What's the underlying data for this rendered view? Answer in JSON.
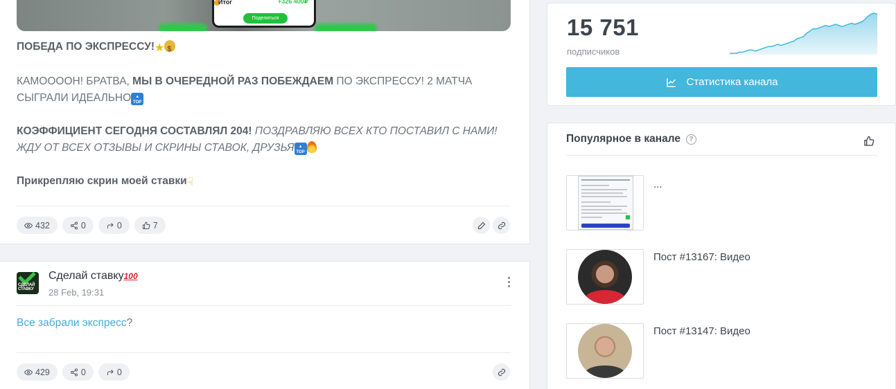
{
  "post1": {
    "image": {
      "itog_label": "Итог",
      "amount": "+326 400₽",
      "share_button": "Поделиться"
    },
    "title": "ПОБЕДА ПО ЭКСПРЕССУ!",
    "para1_a": "КАМООООН! БРАТВА, ",
    "para1_b": "МЫ В ОЧЕРЕДНОЙ РАЗ ПОБЕЖДАЕМ",
    "para1_c": " ПО ЭКСПРЕССУ! 2 МАТЧА СЫГРАЛИ ИДЕАЛЬНО",
    "para2_a": "КОЭФФИЦИЕНТ СЕГОДНЯ СОСТАВЛЯЛ 204!",
    "para2_b": " ПОЗДРАВЛЯЮ ВСЕХ КТО ПОСТАВИЛ С НАМИ! ЖДУ ОТ ВСЕХ ОТЗЫВЫ И СКРИНЫ СТАВОК, ДРУЗЬЯ",
    "para3": "Прикрепляю скрин моей ставки",
    "stats": {
      "views": "432",
      "shares": "0",
      "forwards": "0",
      "likes": "7"
    }
  },
  "post2": {
    "avatar_text": "СДЕЛАЙ СТАВКУ",
    "channel_name": "Сделай ставку",
    "channel_emoji": "100",
    "date": "28 Feb, 19:31",
    "link_text": "Все забрали экспресс",
    "text_suffix": "?",
    "stats": {
      "views": "429",
      "shares": "0",
      "forwards": "0"
    }
  },
  "channel_stats": {
    "subscribers": "15 751",
    "subscribers_label": "подписчиков",
    "stats_button": "Статистика канала",
    "accent_color": "#44b7dd"
  },
  "popular": {
    "title": "Популярное в канале",
    "help_icon": "?",
    "items": [
      {
        "label": "..."
      },
      {
        "label": "Пост #13167: Видео"
      },
      {
        "label": "Пост #13147: Видео"
      }
    ]
  },
  "chart_data": {
    "type": "area",
    "title": "",
    "series": [
      {
        "values": [
          2,
          2,
          2,
          3,
          3,
          4,
          5,
          5,
          4,
          5,
          6,
          7,
          8,
          8,
          9,
          10,
          9,
          10,
          11,
          12,
          13,
          15,
          16,
          17,
          20,
          22,
          24,
          24,
          25,
          26,
          27,
          26,
          27,
          28,
          27,
          26,
          27,
          28,
          29,
          28,
          29,
          30,
          32,
          35,
          37,
          38,
          37
        ]
      }
    ]
  }
}
